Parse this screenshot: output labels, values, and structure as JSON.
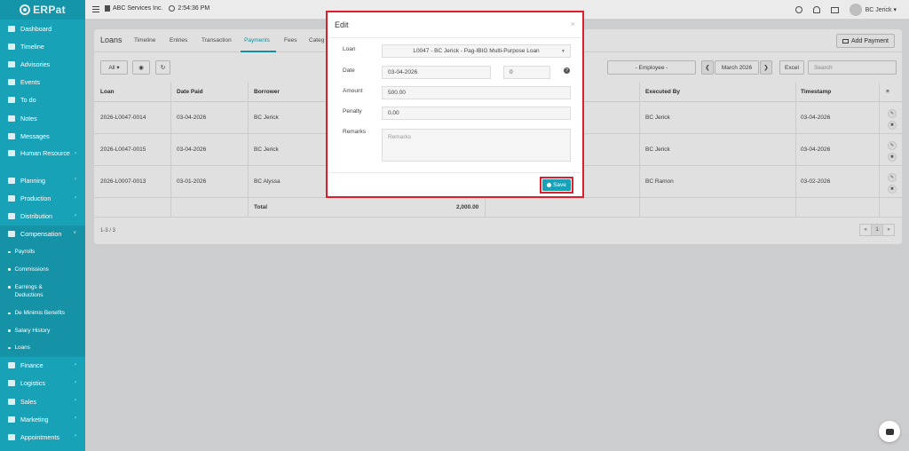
{
  "app": {
    "logo": "ERPat",
    "company": "ABC Services Inc.",
    "time": "2:54:36 PM",
    "user": "BC Jerick ▾"
  },
  "sidebar": {
    "items": [
      {
        "label": "Dashboard",
        "icon": "dashboard-icon"
      },
      {
        "label": "Timeline",
        "icon": "timeline-icon"
      },
      {
        "label": "Advisories",
        "icon": "megaphone-icon"
      },
      {
        "label": "Events",
        "icon": "calendar-icon"
      },
      {
        "label": "To do",
        "icon": "checkbox-icon"
      },
      {
        "label": "Notes",
        "icon": "notes-icon"
      },
      {
        "label": "Messages",
        "icon": "envelope-icon"
      }
    ],
    "human_resource": "Human Resource",
    "planning": "Planning",
    "production": "Production",
    "distribution": "Distribution",
    "compensation": "Compensation",
    "sub_items": [
      "Payrolls",
      "Commissions",
      "Earnings & Deductions",
      "De Minimis Benefits",
      "Salary History",
      "Loans"
    ],
    "bottom_items": [
      "Finance",
      "Logistics",
      "Sales",
      "Marketing",
      "Appointments"
    ]
  },
  "tabs": {
    "title": "Loans",
    "items": [
      "Timeline",
      "Entries",
      "Transaction",
      "Payments",
      "Fees",
      "Categ"
    ],
    "add_payment": "Add Payment"
  },
  "controls": {
    "filter_all": "All ▾",
    "employee": "- Employee -",
    "month": "March 2026",
    "excel": "Excel",
    "search_placeholder": "Search"
  },
  "table": {
    "headers": [
      "Loan",
      "Date Paid",
      "Borrower",
      "Executed By",
      "Timestamp"
    ],
    "rows": [
      {
        "loan": "2026-L0047-0014",
        "date": "03-04-2026",
        "borrower": "BC Jerick",
        "executed": "BC Jerick",
        "timestamp": "03-04-2026"
      },
      {
        "loan": "2026-L0047-0015",
        "date": "03-04-2026",
        "borrower": "BC Jerick",
        "executed": "BC Jerick",
        "timestamp": "03-04-2026"
      },
      {
        "loan": "2026-L0007-0013",
        "date": "03-01-2026",
        "borrower": "BC Alyssa",
        "executed": "BC Ramon",
        "timestamp": "03-02-2026"
      }
    ],
    "total_label": "Total",
    "total_value": "2,000.00",
    "pager_info": "1-3 / 3",
    "page": "1"
  },
  "modal": {
    "title": "Edit",
    "close": "×",
    "loan_label": "Loan",
    "loan_value": "L0047 - BC Jerick - Pag-IBIG Multi-Purpose Loan",
    "date_label": "Date",
    "date_value": "03-04-2026",
    "date_extra": "0",
    "amount_label": "Amount",
    "amount_value": "500.00",
    "penalty_label": "Penalty",
    "penalty_value": "0.00",
    "remarks_label": "Remarks",
    "remarks_placeholder": "Remarks",
    "save": "Save"
  },
  "colors": {
    "brand": "#17a2b8",
    "highlight": "#e01e2b"
  }
}
